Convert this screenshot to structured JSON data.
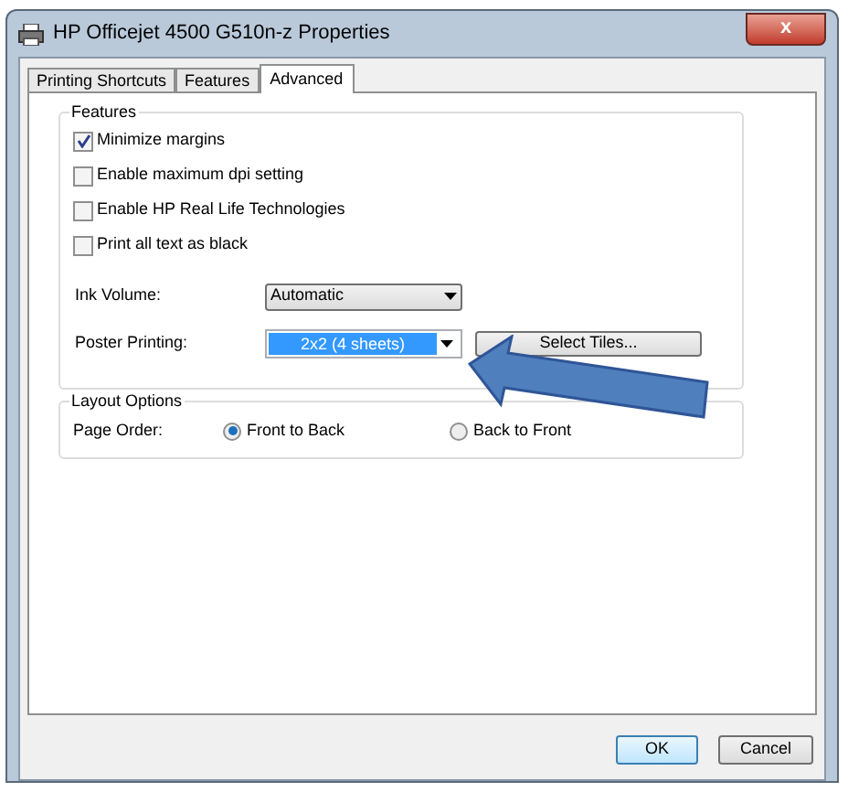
{
  "window": {
    "title": "HP Officejet 4500 G510n-z Properties",
    "close": "x"
  },
  "tabs": [
    {
      "label": "Printing Shortcuts",
      "selected": false
    },
    {
      "label": "Features",
      "selected": false
    },
    {
      "label": "Advanced",
      "selected": true
    }
  ],
  "features": {
    "title": "Features",
    "checkboxes": [
      {
        "label": "Minimize margins",
        "checked": true
      },
      {
        "label": "Enable maximum dpi setting",
        "checked": false
      },
      {
        "label": "Enable HP Real Life Technologies",
        "checked": false
      },
      {
        "label": "Print all text as black",
        "checked": false
      }
    ],
    "ink_volume": {
      "label": "Ink Volume:",
      "value": "Automatic"
    },
    "poster_printing": {
      "label": "Poster Printing:",
      "value": "2x2 (4 sheets)",
      "focused": true,
      "button": "Select Tiles..."
    }
  },
  "layout_options": {
    "title": "Layout Options",
    "label": "Page Order:",
    "radios": [
      {
        "label": "Front to Back",
        "selected": true
      },
      {
        "label": "Back to Front",
        "selected": false
      }
    ]
  },
  "buttons": [
    {
      "label": "OK",
      "default": true
    },
    {
      "label": "Cancel",
      "default": false
    }
  ]
}
